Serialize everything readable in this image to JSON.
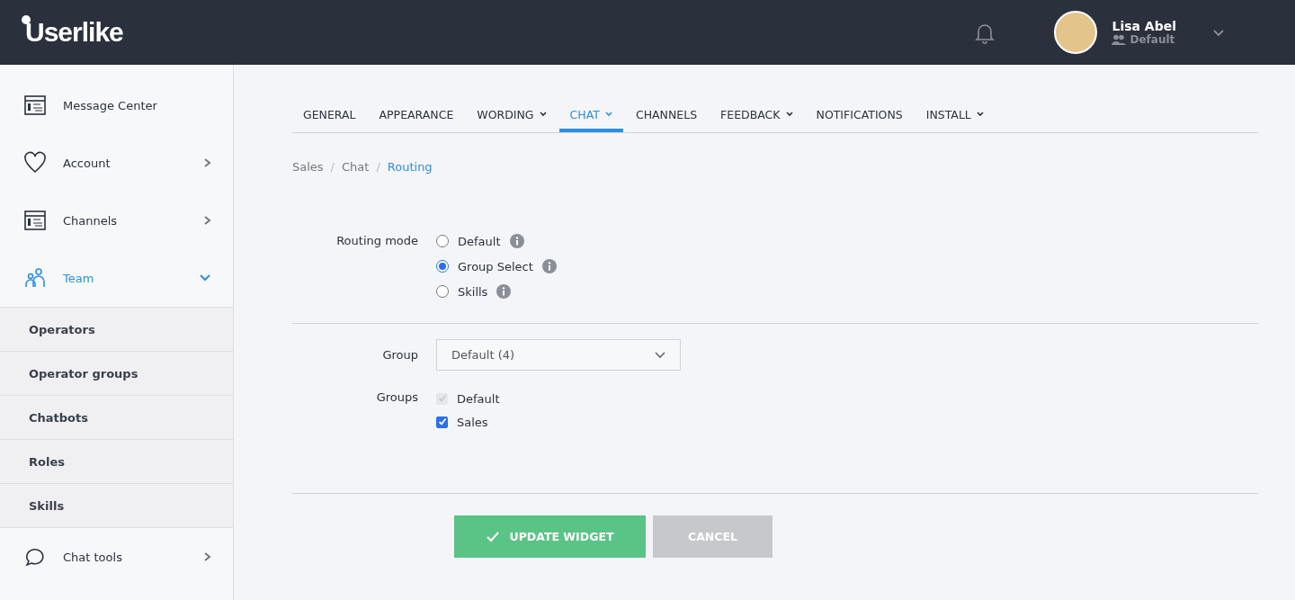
{
  "header": {
    "logo": "Userlike",
    "user": {
      "name": "Lisa Abel",
      "role": "Default"
    }
  },
  "sidebar": {
    "items": [
      {
        "label": "Message Center",
        "kind": "window",
        "has_arrow": false,
        "selected": false
      },
      {
        "label": "Account",
        "kind": "heart",
        "has_arrow": true,
        "expanded": false,
        "selected": false
      },
      {
        "label": "Channels",
        "kind": "window",
        "has_arrow": true,
        "expanded": false,
        "selected": false
      },
      {
        "label": "Team",
        "kind": "people",
        "has_arrow": true,
        "expanded": true,
        "selected": true,
        "children": [
          {
            "label": "Operators"
          },
          {
            "label": "Operator groups"
          },
          {
            "label": "Chatbots"
          },
          {
            "label": "Roles"
          },
          {
            "label": "Skills"
          }
        ]
      },
      {
        "label": "Chat tools",
        "kind": "bubble",
        "has_arrow": true,
        "expanded": false,
        "selected": false
      }
    ]
  },
  "tabs": [
    {
      "label": "GENERAL",
      "dropdown": false,
      "selected": false
    },
    {
      "label": "APPEARANCE",
      "dropdown": false,
      "selected": false
    },
    {
      "label": "WORDING",
      "dropdown": true,
      "selected": false
    },
    {
      "label": "CHAT",
      "dropdown": true,
      "selected": true
    },
    {
      "label": "CHANNELS",
      "dropdown": false,
      "selected": false
    },
    {
      "label": "FEEDBACK",
      "dropdown": true,
      "selected": false
    },
    {
      "label": "NOTIFICATIONS",
      "dropdown": false,
      "selected": false
    },
    {
      "label": "INSTALL",
      "dropdown": true,
      "selected": false
    }
  ],
  "breadcrumb": [
    {
      "label": "Sales",
      "kind": "link",
      "selected": false
    },
    {
      "label": "/",
      "kind": "separator"
    },
    {
      "label": "Chat",
      "kind": "link",
      "selected": false
    },
    {
      "label": "/",
      "kind": "separator"
    },
    {
      "label": "Routing",
      "kind": "link",
      "selected": true
    }
  ],
  "routing_mode": {
    "label": "Routing mode",
    "options": [
      {
        "label": "Default",
        "selected": false
      },
      {
        "label": "Group Select",
        "selected": true
      },
      {
        "label": "Skills",
        "selected": false
      }
    ]
  },
  "group": {
    "label": "Group",
    "value": "Default (4)"
  },
  "groups": {
    "label": "Groups",
    "options": [
      {
        "label": "Default",
        "checked": true,
        "disabled": true
      },
      {
        "label": "Sales",
        "checked": true,
        "disabled": false
      }
    ]
  },
  "buttons": [
    {
      "label": "UPDATE WIDGET",
      "kind": "primary"
    },
    {
      "label": "CANCEL",
      "kind": "secondary"
    }
  ]
}
